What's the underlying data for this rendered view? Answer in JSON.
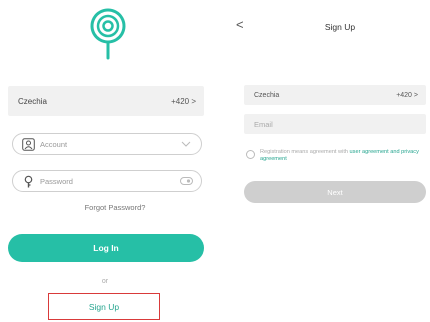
{
  "brand": {
    "accent": "#26bfa6",
    "link": "#26a58f",
    "highlight": "#d93a3a",
    "disabled": "#cfcfcf"
  },
  "login": {
    "country": {
      "name": "Czechia",
      "code": "+420 >"
    },
    "account": {
      "placeholder": "Account",
      "icon": "user-icon",
      "trailing_icon": "chevron-down-icon"
    },
    "password": {
      "placeholder": "Password",
      "icon": "lock-icon",
      "trailing_icon": "eye-off-icon"
    },
    "forgot": "Forgot Password?",
    "login_button": "Log In",
    "or": "or",
    "signup_link": "Sign Up"
  },
  "signup": {
    "back": "<",
    "title": "Sign Up",
    "country": {
      "name": "Czechia",
      "code": "+420 >"
    },
    "email_placeholder": "Email",
    "agreement": {
      "text": "Registration means agreement with ",
      "link": "user agreement and privacy agreement"
    },
    "next_button": "Next"
  }
}
